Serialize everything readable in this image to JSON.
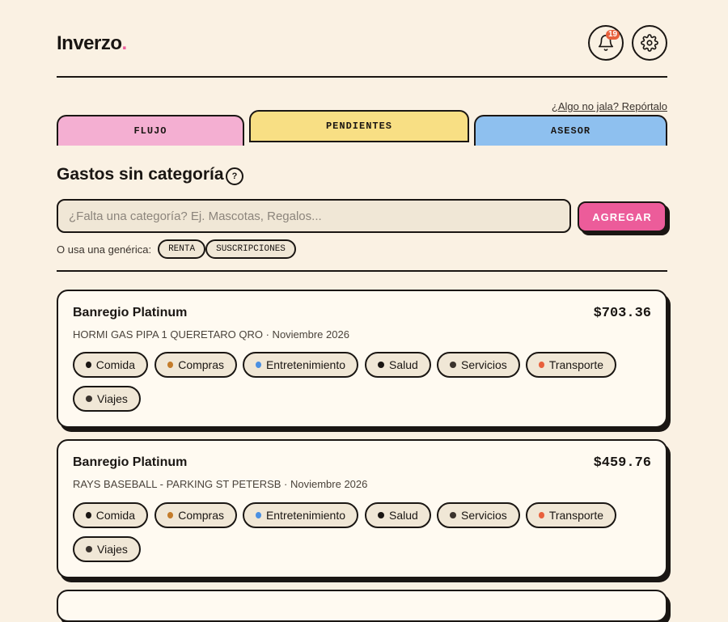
{
  "app": {
    "logo": "Inverzo",
    "logo_dot": "."
  },
  "header": {
    "notification_count": "19"
  },
  "report_link": "¿Algo no jala? Repórtalo",
  "tabs": [
    {
      "label": "FLUJO",
      "active": false
    },
    {
      "label": "PENDIENTES",
      "active": true
    },
    {
      "label": "ASESOR",
      "active": false
    }
  ],
  "section": {
    "title": "Gastos sin categoría",
    "help": "?",
    "input_placeholder": "¿Falta una categoría? Ej. Mascotas, Regalos...",
    "input_value": "",
    "add_button": "AGREGAR",
    "generic_label": "O usa una genérica:",
    "generic_options": [
      "RENTA",
      "SUSCRIPCIONES"
    ]
  },
  "categories": [
    {
      "label": "Comida",
      "color": "#1a1613"
    },
    {
      "label": "Compras",
      "color": "#c47c2a"
    },
    {
      "label": "Entretenimiento",
      "color": "#4a90e2"
    },
    {
      "label": "Salud",
      "color": "#1a1613"
    },
    {
      "label": "Servicios",
      "color": "#3a332d"
    },
    {
      "label": "Transporte",
      "color": "#e8603c"
    },
    {
      "label": "Viajes",
      "color": "#3a332d"
    }
  ],
  "transactions": [
    {
      "account": "Banregio Platinum",
      "amount": "$703.36",
      "description": "HORMI GAS PIPA 1 QUERETARO QRO · Noviembre 2026"
    },
    {
      "account": "Banregio Platinum",
      "amount": "$459.76",
      "description": "RAYS BASEBALL - PARKING ST PETERSB · Noviembre 2026"
    }
  ]
}
